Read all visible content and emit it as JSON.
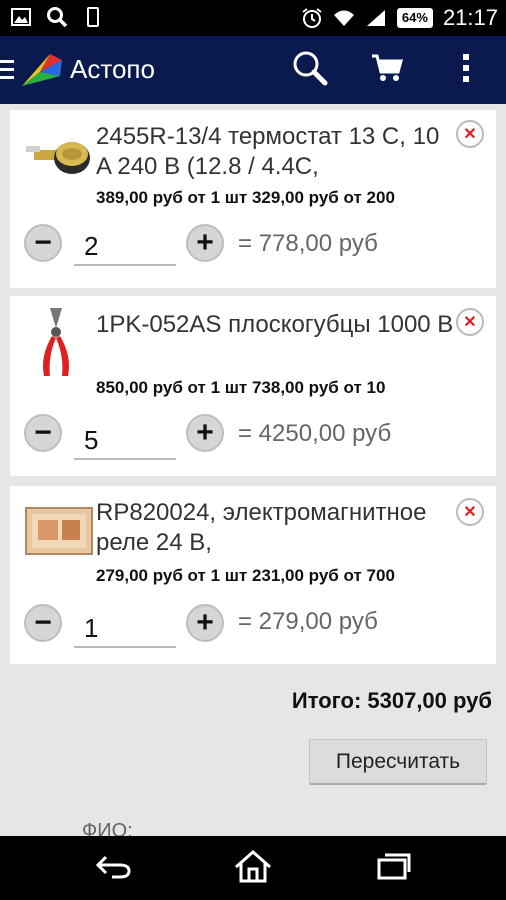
{
  "status_bar": {
    "battery": "64%",
    "time": "21:17"
  },
  "app_bar": {
    "title": "Астопо"
  },
  "cart": {
    "items": [
      {
        "name": "2455R-13/4 термостат 13 C, 10 A 240 B (12.8 / 4.4C,",
        "price_line": "389,00 руб от 1 шт  329,00 руб от 200",
        "quantity": "2",
        "line_total": "= 778,00 руб"
      },
      {
        "name": "1PK-052AS плоскогубцы 1000 B",
        "price_line": "850,00 руб от 1 шт  738,00 руб от 10",
        "quantity": "5",
        "line_total": "= 4250,00 руб"
      },
      {
        "name": "RP820024, электромагнитное реле 24 B,",
        "price_line": "279,00 руб от 1 шт  231,00 руб от 700",
        "quantity": "1",
        "line_total": "= 279,00 руб"
      }
    ],
    "total": "Итого: 5307,00 руб",
    "recalc_label": "Пересчитать",
    "fio_label": "ФИО:"
  },
  "icons": {
    "minus": "−",
    "plus": "+",
    "remove": "✕"
  },
  "colors": {
    "app_bar": "#0a1a4e",
    "remove_icon": "#e02020",
    "background": "#e6e6e6"
  }
}
